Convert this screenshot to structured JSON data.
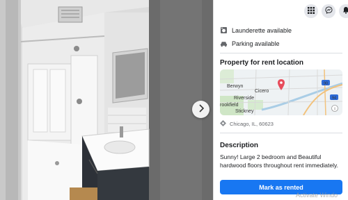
{
  "gallery": {
    "next_icon": "chevron-right-icon"
  },
  "topbar": {
    "icons": [
      "apps-grid-icon",
      "messenger-icon",
      "notifications-icon"
    ]
  },
  "features": [
    {
      "icon": "laundry-icon",
      "label": "Launderette available"
    },
    {
      "icon": "car-icon",
      "label": "Parking available"
    }
  ],
  "location": {
    "heading": "Property for rent location",
    "map_labels": {
      "berwyn": "Berwyn",
      "cicero": "Cicero",
      "riverside": "Riverside",
      "brookfield": "rookfield",
      "stickney": "Stickney",
      "route1": "90",
      "route2": "55",
      "route3": "94"
    },
    "address": "Chicago, IL, 60623",
    "address_icon": "location-arrow-icon",
    "pin_color": "#e74c5b"
  },
  "description": {
    "heading": "Description",
    "text": "Sunny! Large 2 bedroom and Beautiful hardwood floors throughout rent immediately."
  },
  "actions": {
    "mark_rented": "Mark as rented",
    "accent": "#1877f2"
  },
  "watermark": "Activate Windo"
}
